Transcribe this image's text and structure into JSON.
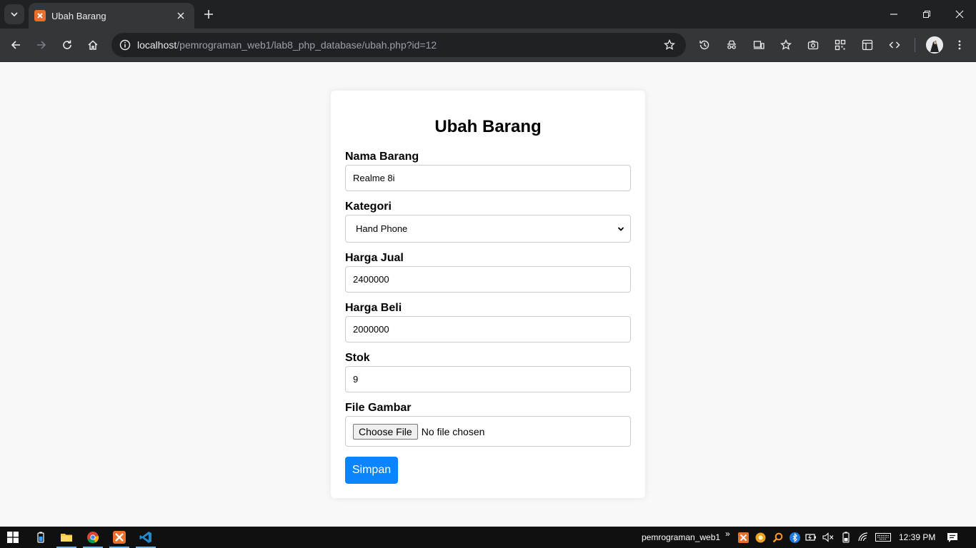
{
  "browser": {
    "tab_title": "Ubah Barang",
    "url_host": "localhost",
    "url_path": "/pemrograman_web1/lab8_php_database/ubah.php?id=12"
  },
  "form": {
    "title": "Ubah Barang",
    "nama_label": "Nama Barang",
    "nama_value": "Realme 8i",
    "kategori_label": "Kategori",
    "kategori_value": "Hand Phone",
    "harga_jual_label": "Harga Jual",
    "harga_jual_value": "2400000",
    "harga_beli_label": "Harga Beli",
    "harga_beli_value": "2000000",
    "stok_label": "Stok",
    "stok_value": "9",
    "gambar_label": "File Gambar",
    "file_button": "Choose File",
    "file_status": "No file chosen",
    "submit_label": "Simpan"
  },
  "taskbar": {
    "window_label": "pemrograman_web1",
    "overflow": "»",
    "time": "12:39 PM"
  },
  "colors": {
    "page_bg": "#f8f8f8",
    "submit_bg": "#0a84ff",
    "chrome_dark": "#202124",
    "chrome_mid": "#35363a"
  }
}
